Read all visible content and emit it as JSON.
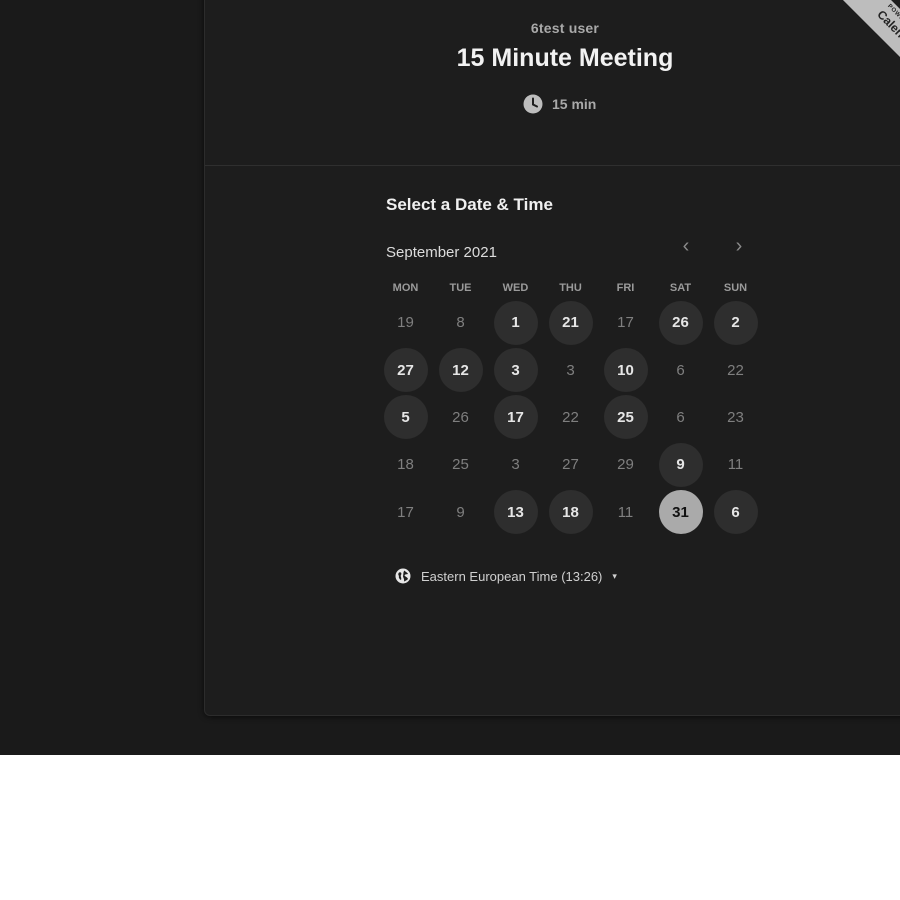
{
  "header": {
    "host_name": "6test user",
    "event_title": "15 Minute Meeting",
    "duration": "15 min",
    "duration_icon": "clock-icon"
  },
  "badge": {
    "line1": "POWERED BY",
    "line2": "Calendly"
  },
  "calendar": {
    "section_title": "Select a Date & Time",
    "month_label": "September 2021",
    "prev_icon": "chevron-left-icon",
    "next_icon": "chevron-right-icon",
    "prev_glyph": "‹",
    "next_glyph": "›",
    "weekdays": [
      "MON",
      "TUE",
      "WED",
      "THU",
      "FRI",
      "SAT",
      "SUN"
    ],
    "rows": [
      [
        {
          "d": "19",
          "s": "off"
        },
        {
          "d": "8",
          "s": "off"
        },
        {
          "d": "1",
          "s": "avail"
        },
        {
          "d": "21",
          "s": "avail"
        },
        {
          "d": "17",
          "s": "off"
        },
        {
          "d": "26",
          "s": "avail"
        },
        {
          "d": "2",
          "s": "avail"
        }
      ],
      [
        {
          "d": "27",
          "s": "avail"
        },
        {
          "d": "12",
          "s": "avail"
        },
        {
          "d": "3",
          "s": "avail"
        },
        {
          "d": "3",
          "s": "off"
        },
        {
          "d": "10",
          "s": "avail"
        },
        {
          "d": "6",
          "s": "off"
        },
        {
          "d": "22",
          "s": "off"
        }
      ],
      [
        {
          "d": "5",
          "s": "avail"
        },
        {
          "d": "26",
          "s": "off"
        },
        {
          "d": "17",
          "s": "avail"
        },
        {
          "d": "22",
          "s": "off"
        },
        {
          "d": "25",
          "s": "avail"
        },
        {
          "d": "6",
          "s": "off"
        },
        {
          "d": "23",
          "s": "off"
        }
      ],
      [
        {
          "d": "18",
          "s": "off"
        },
        {
          "d": "25",
          "s": "off"
        },
        {
          "d": "3",
          "s": "off"
        },
        {
          "d": "27",
          "s": "off"
        },
        {
          "d": "29",
          "s": "off"
        },
        {
          "d": "9",
          "s": "avail"
        },
        {
          "d": "11",
          "s": "off"
        }
      ],
      [
        {
          "d": "17",
          "s": "off"
        },
        {
          "d": "9",
          "s": "off"
        },
        {
          "d": "13",
          "s": "avail"
        },
        {
          "d": "18",
          "s": "avail"
        },
        {
          "d": "11",
          "s": "off"
        },
        {
          "d": "31",
          "s": "selected"
        },
        {
          "d": "6",
          "s": "avail"
        }
      ]
    ]
  },
  "timezone": {
    "label": "Eastern European Time (13:26)",
    "icon": "globe-icon",
    "caret": "▾"
  }
}
